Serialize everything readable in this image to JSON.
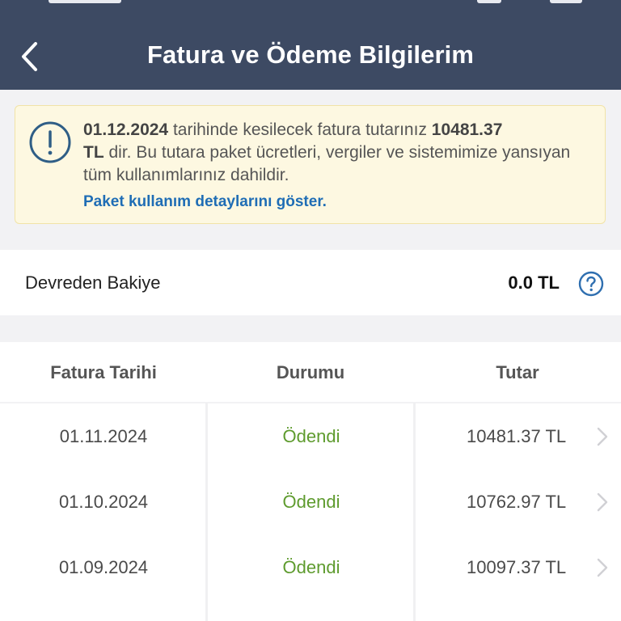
{
  "header": {
    "title": "Fatura ve Ödeme Bilgilerim",
    "background": "#3d4a63"
  },
  "notice": {
    "date": "01.12.2024",
    "text_mid": " tarihinde kesilecek fatura tutarınız ",
    "amount": "10481.37",
    "currency": "TL",
    "text_end": " dir. Bu tutara paket ücretleri, vergiler ve sistemimize yansıyan tüm kullanımlarınız dahildir.",
    "link": "Paket kullanım detaylarını göster.",
    "icon": "info-exclamation-icon",
    "link_color": "#1f6db5"
  },
  "balance": {
    "label": "Devreden Bakiye",
    "value": "0.0 TL",
    "help_icon": "question-circle-icon"
  },
  "table": {
    "headers": {
      "date": "Fatura Tarihi",
      "status": "Durumu",
      "amount": "Tutar"
    },
    "rows": [
      {
        "date": "01.11.2024",
        "status": "Ödendi",
        "amount": "10481.37 TL"
      },
      {
        "date": "01.10.2024",
        "status": "Ödendi",
        "amount": "10762.97 TL"
      },
      {
        "date": "01.09.2024",
        "status": "Ödendi",
        "amount": "10097.37 TL"
      }
    ],
    "status_color": "#5e9b2e"
  }
}
